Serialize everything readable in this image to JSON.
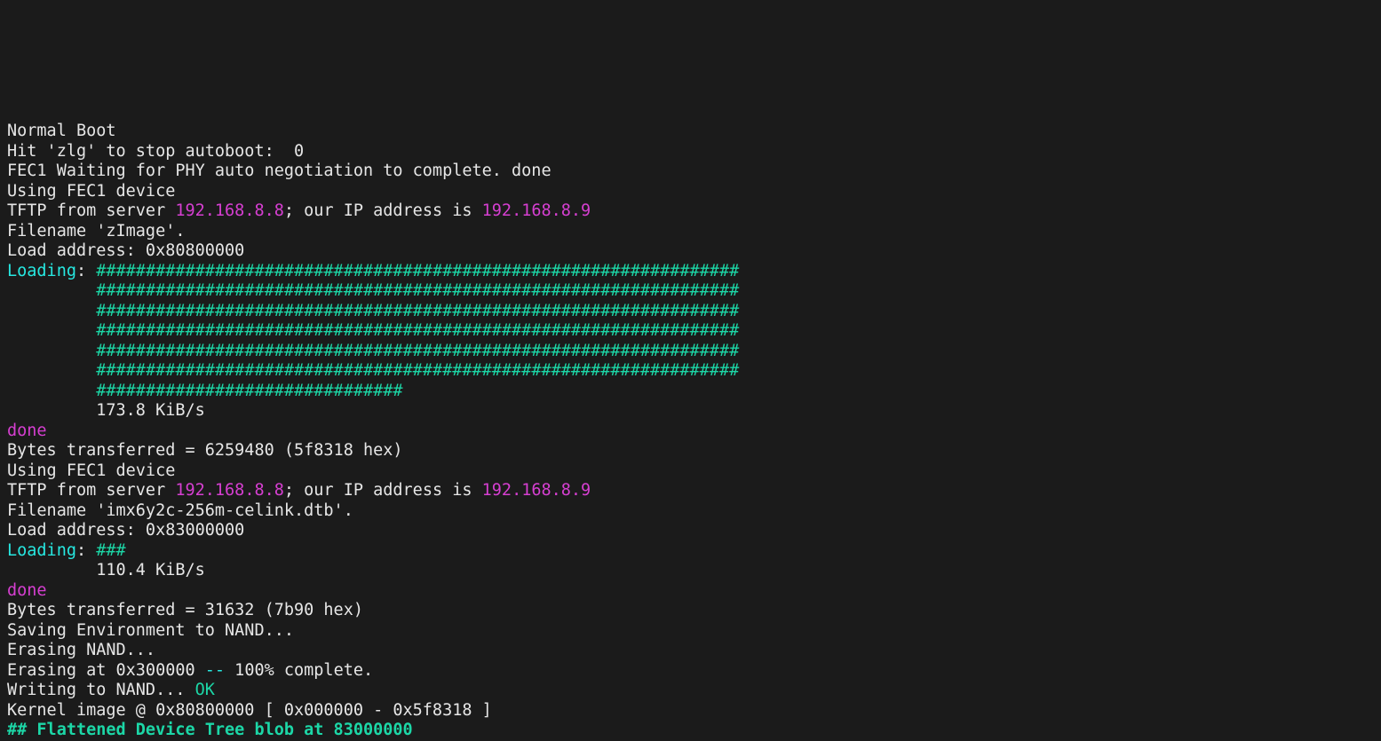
{
  "colors": {
    "bg": "#1b1b1b",
    "fg": "#e6e6e6",
    "cyan": "#27e8e1",
    "magenta": "#d63fd1",
    "green": "#1cd7a7"
  },
  "lines": {
    "l01": "Normal Boot",
    "l02": "Hit 'zlg' to stop autoboot:  0",
    "l03": "FEC1 Waiting for PHY auto negotiation to complete. done",
    "l04": "Using FEC1 device",
    "l05a": "TFTP from server ",
    "l05b": "192.168.8.8",
    "l05c": "; our IP address is ",
    "l05d": "192.168.8.9",
    "l06": "Filename 'zImage'.",
    "l07": "Load address: 0x80800000",
    "l08a": "Loading",
    "l08b": ": ",
    "hash65": "#################################################################",
    "hash31": "###############################",
    "l15": "         173.8 KiB/s",
    "l16": "done",
    "l17": "Bytes transferred = 6259480 (5f8318 hex)",
    "l18": "Using FEC1 device",
    "l19a": "TFTP from server ",
    "l19b": "192.168.8.8",
    "l19c": "; our IP address is ",
    "l19d": "192.168.8.9",
    "l20": "Filename 'imx6y2c-256m-celink.dtb'.",
    "l21": "Load address: 0x83000000",
    "l22a": "Loading",
    "l22b": ": ",
    "l22c": "###",
    "l23": "         110.4 KiB/s",
    "l24": "done",
    "l25": "Bytes transferred = 31632 (7b90 hex)",
    "l26": "Saving Environment to NAND...",
    "l27": "Erasing NAND...",
    "l28a": "Erasing at 0x300000 ",
    "l28b": "--",
    "l28c": " 100% complete.",
    "l29a": "Writing to NAND... ",
    "l29b": "OK",
    "l30": "Kernel image @ 0x80800000 [ 0x000000 - 0x5f8318 ]",
    "l31": "## Flattened Device Tree blob at 83000000"
  }
}
